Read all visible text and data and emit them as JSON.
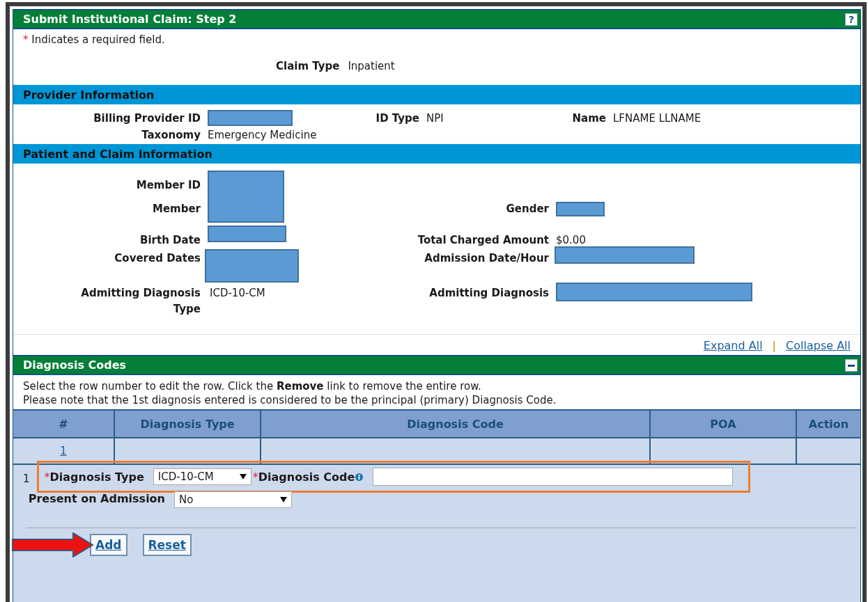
{
  "header": {
    "title": "Submit Institutional Claim: Step 2",
    "help_icon": "?"
  },
  "required_note": {
    "marker": "*",
    "text": "Indicates a required field."
  },
  "claim_type": {
    "label": "Claim Type",
    "value": "Inpatient"
  },
  "provider": {
    "title": "Provider Information",
    "billing_provider_id": {
      "label": "Billing Provider ID",
      "redacted": true
    },
    "id_type": {
      "label": "ID Type",
      "value": "NPI"
    },
    "name": {
      "label": "Name",
      "value": "LFNAME LLNAME"
    },
    "taxonomy": {
      "label": "Taxonomy",
      "value": "Emergency Medicine"
    }
  },
  "patient": {
    "title": "Patient and Claim Information",
    "member_id": {
      "label": "Member ID",
      "redacted": true
    },
    "member": {
      "label": "Member"
    },
    "gender": {
      "label": "Gender",
      "redacted": true
    },
    "birth_date": {
      "label": "Birth Date",
      "redacted": true
    },
    "total_charged_amount": {
      "label": "Total Charged Amount",
      "value": "$0.00"
    },
    "covered_dates": {
      "label": "Covered Dates",
      "redacted": true
    },
    "admission_date_hour": {
      "label": "Admission Date/Hour",
      "redacted": true
    },
    "admitting_diagnosis_type": {
      "label": "Admitting Diagnosis Type",
      "value": "ICD-10-CM"
    },
    "admitting_diagnosis": {
      "label": "Admitting Diagnosis",
      "redacted": true
    }
  },
  "links": [
    {
      "label": "Expand All"
    },
    {
      "label": "Collapse All"
    }
  ],
  "link_separator": "|",
  "diagnosis": {
    "title": "Diagnosis Codes",
    "expanded": true,
    "instructions": [
      "Select the row number to edit the row. Click the **Remove** link to remove the entire row.",
      "Please note that the 1st diagnosis entered is considered to be the principal (primary) Diagnosis Code."
    ],
    "table": {
      "columns": [
        "#",
        "Diagnosis Type",
        "Diagnosis Code",
        "POA",
        "Action"
      ],
      "rows": [
        {
          "number": "1"
        }
      ]
    },
    "edit_form": {
      "row_number": "1",
      "highlighted": true,
      "diagnosis_type": {
        "marker": "*",
        "label": "Diagnosis Type",
        "value": "ICD-10-CM"
      },
      "diagnosis_code": {
        "marker": "*",
        "label": "Diagnosis Code"
      },
      "present_on_admission": {
        "label": "Present on Admission",
        "value": "No"
      }
    },
    "buttons": [
      {
        "label": "Add",
        "pointed": true
      },
      {
        "label": "Reset",
        "pointed": false
      }
    ]
  }
}
